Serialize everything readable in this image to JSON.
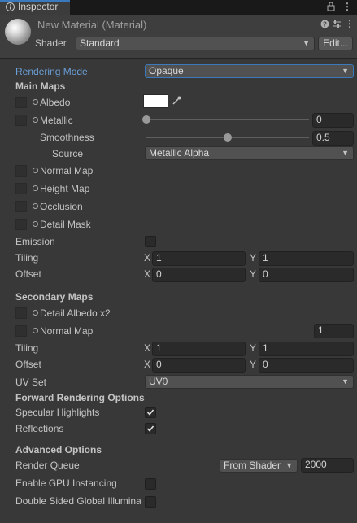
{
  "tab": {
    "label": "Inspector",
    "icon": "info-icon"
  },
  "window_icons": [
    "lock-icon",
    "menu-icon"
  ],
  "header": {
    "title": "New Material (Material)",
    "shader_label": "Shader",
    "shader_value": "Standard",
    "edit_label": "Edit...",
    "icons": [
      "help-icon",
      "settings-icon",
      "more-icon"
    ]
  },
  "rendering_mode": {
    "label": "Rendering Mode",
    "value": "Opaque"
  },
  "main_maps": {
    "title": "Main Maps",
    "albedo": "Albedo",
    "albedo_color": "#ffffff",
    "metallic": {
      "label": "Metallic",
      "value": "0",
      "level": 0
    },
    "smoothness": {
      "label": "Smoothness",
      "value": "0.5",
      "level": 0.5
    },
    "source": {
      "label": "Source",
      "value": "Metallic Alpha"
    },
    "normal_map": "Normal Map",
    "height_map": "Height Map",
    "occlusion": "Occlusion",
    "detail_mask": "Detail Mask",
    "emission": {
      "label": "Emission",
      "checked": false
    },
    "tiling": {
      "label": "Tiling",
      "x": "1",
      "y": "1"
    },
    "offset": {
      "label": "Offset",
      "x": "0",
      "y": "0"
    }
  },
  "axes": {
    "x": "X",
    "y": "Y"
  },
  "secondary_maps": {
    "title": "Secondary Maps",
    "detail_albedo": "Detail Albedo x2",
    "normal_map": "Normal Map",
    "normal_scale": "1",
    "tiling": {
      "label": "Tiling",
      "x": "1",
      "y": "1"
    },
    "offset": {
      "label": "Offset",
      "x": "0",
      "y": "0"
    },
    "uv_set": {
      "label": "UV Set",
      "value": "UV0"
    }
  },
  "forward_rendering": {
    "title": "Forward Rendering Options",
    "specular_highlights": {
      "label": "Specular Highlights",
      "checked": true
    },
    "reflections": {
      "label": "Reflections",
      "checked": true
    }
  },
  "advanced": {
    "title": "Advanced Options",
    "render_queue": {
      "label": "Render Queue",
      "mode": "From Shader",
      "value": "2000"
    },
    "gpu_instancing": {
      "label": "Enable GPU Instancing",
      "checked": false
    },
    "double_sided": {
      "label": "Double Sided Global Illumina",
      "checked": false
    }
  }
}
